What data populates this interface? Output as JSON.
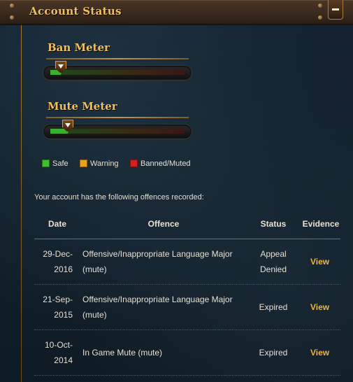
{
  "header": {
    "title": "Account Status",
    "collapse_icon": "minus-icon"
  },
  "meters": {
    "ban": {
      "label": "Ban Meter",
      "level": 0.08
    },
    "mute": {
      "label": "Mute Meter",
      "level": 0.13
    }
  },
  "legend": {
    "safe": {
      "label": "Safe",
      "color": "#3cc02c"
    },
    "warning": {
      "label": "Warning",
      "color": "#e8a21c"
    },
    "banned": {
      "label": "Banned/Muted",
      "color": "#d42020"
    }
  },
  "offences": {
    "intro": "Your account has the following offences recorded:",
    "columns": {
      "date": "Date",
      "offence": "Offence",
      "status": "Status",
      "evidence": "Evidence"
    },
    "rows": [
      {
        "date_line1": "29-Dec-",
        "date_line2": "2016",
        "offence_line1": "Offensive/Inappropriate Language Major",
        "offence_line2": "(mute)",
        "status_line1": "Appeal",
        "status_line2": "Denied",
        "evidence": "View"
      },
      {
        "date_line1": "21-Sep-",
        "date_line2": "2015",
        "offence_line1": "Offensive/Inappropriate Language Major",
        "offence_line2": "(mute)",
        "status_line1": "Expired",
        "status_line2": "",
        "evidence": "View"
      },
      {
        "date_line1": "10-Oct-",
        "date_line2": "2014",
        "offence_line1": "In Game Mute (mute)",
        "offence_line2": "",
        "status_line1": "Expired",
        "status_line2": "",
        "evidence": "View"
      }
    ]
  },
  "colors": {
    "accent_gold": "#f0c060",
    "link": "#f0b43c"
  }
}
